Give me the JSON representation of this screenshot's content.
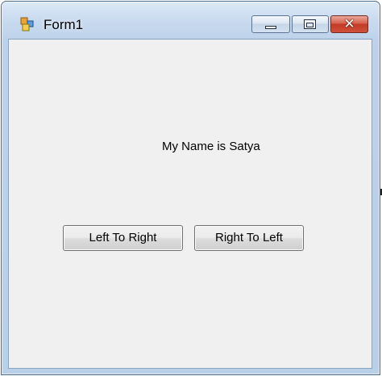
{
  "window": {
    "title": "Form1",
    "icon": "winforms-app-icon",
    "caption_buttons": {
      "minimize_icon": "minimize-icon",
      "maximize_icon": "maximize-icon",
      "close_icon": "close-icon",
      "close_glyph": "✕"
    }
  },
  "form": {
    "label_text": "My Name is Satya",
    "buttons": {
      "left_to_right": "Left To Right",
      "right_to_left": "Right To Left"
    }
  },
  "colors": {
    "client_background": "#f0f0f0",
    "close_button_red": "#c23a25",
    "title_bar_blue": "#c7d9ee"
  }
}
